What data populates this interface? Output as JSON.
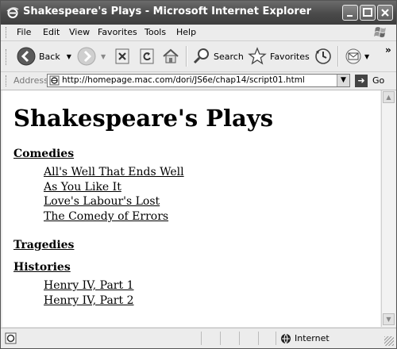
{
  "window": {
    "title": "Shakespeare's Plays - Microsoft Internet Explorer"
  },
  "menu": [
    "File",
    "Edit",
    "View",
    "Favorites",
    "Tools",
    "Help"
  ],
  "toolbar": {
    "back_label": "Back",
    "search_label": "Search",
    "favorites_label": "Favorites",
    "overflow": "»"
  },
  "address": {
    "label": "Address",
    "url": "http://homepage.mac.com/dori/JS6e/chap14/script01.html",
    "go_label": "Go"
  },
  "page": {
    "heading": "Shakespeare's Plays",
    "comedies": {
      "label": "Comedies",
      "plays": [
        "All's Well That Ends Well",
        "As You Like It",
        "Love's Labour's Lost",
        "The Comedy of Errors"
      ]
    },
    "tragedies": {
      "label": "Tragedies"
    },
    "histories": {
      "label": "Histories",
      "plays": [
        "Henry IV, Part 1",
        "Henry IV, Part 2"
      ]
    }
  },
  "status": {
    "zone": "Internet"
  }
}
